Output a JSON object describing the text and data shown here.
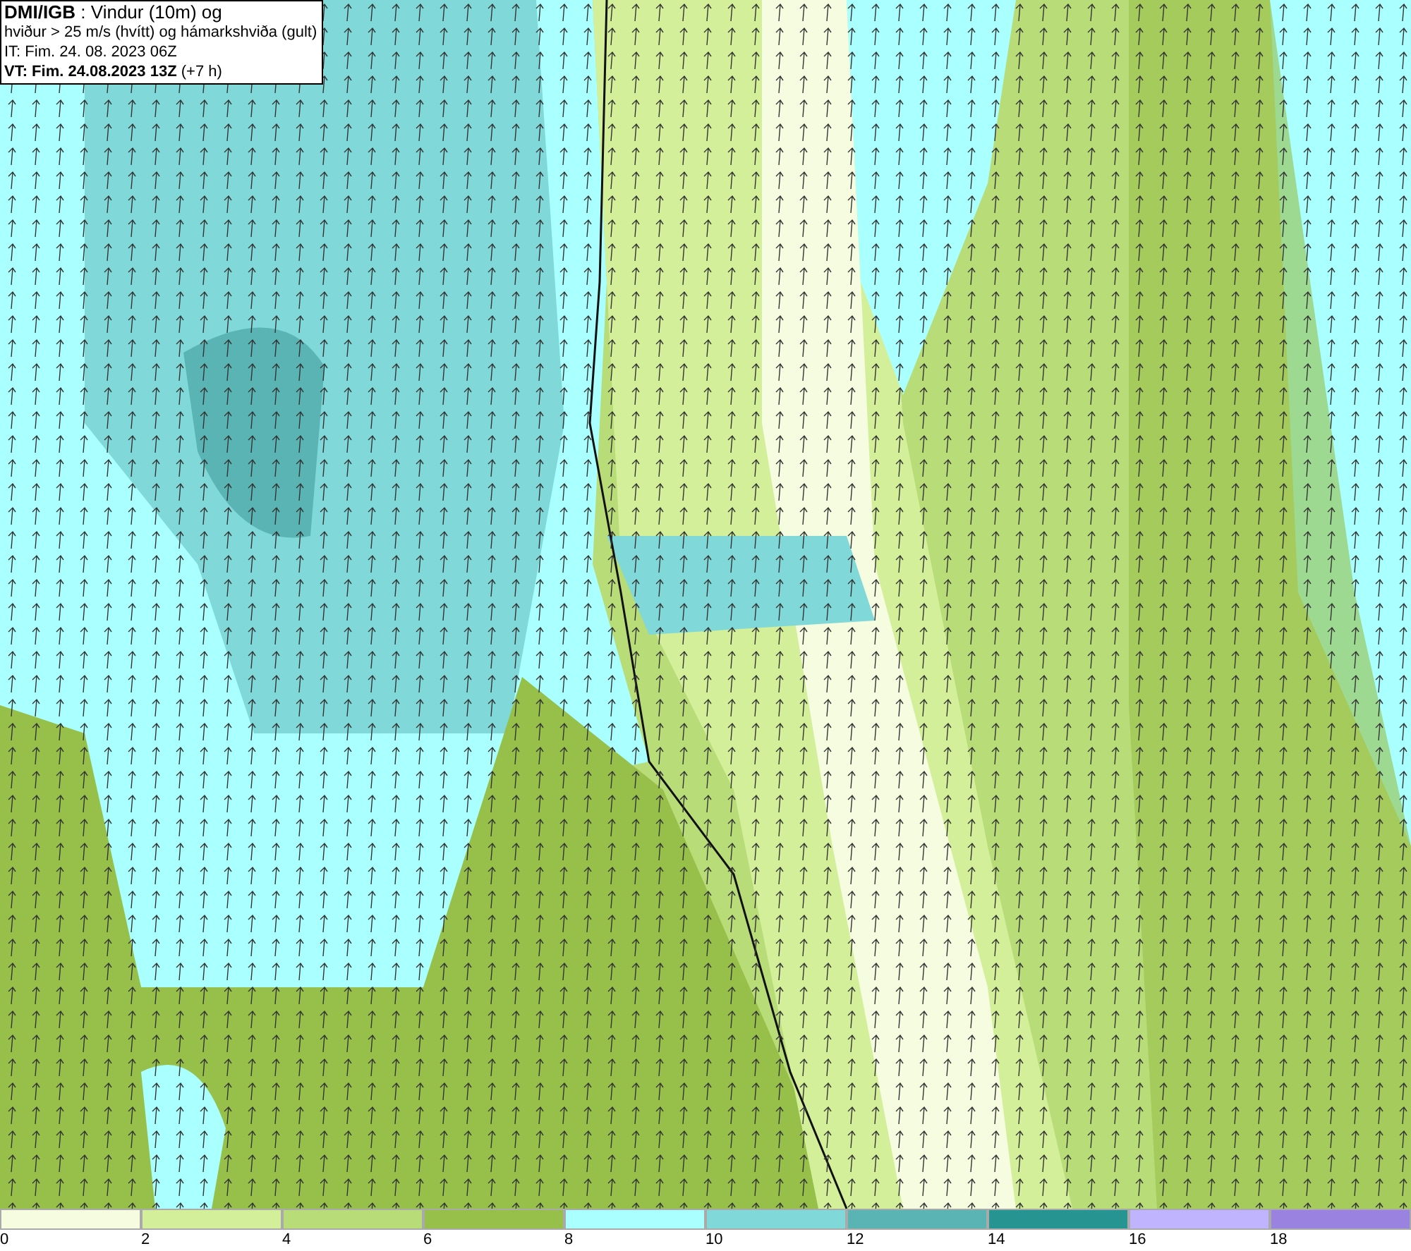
{
  "header": {
    "lines": [
      "**DMI/IGB** : Vindur (10m) og",
      "hviður > 25 m/s (hvítt) og hámarkshviða (gult)",
      "IT: Fim. 24. 08. 2023 06Z",
      "**VT: Fim. 24.08.2023 13Z** (+7 h)"
    ]
  },
  "legend": {
    "bins": [
      {
        "color": "#f5fce0",
        "label": "0"
      },
      {
        "color": "#d4ef9a",
        "label": "2"
      },
      {
        "color": "#b8dc78",
        "label": "4"
      },
      {
        "color": "#96c04a",
        "label": "6"
      },
      {
        "color": "#aaffff",
        "label": "8"
      },
      {
        "color": "#80d8d8",
        "label": "10"
      },
      {
        "color": "#5ab4b4",
        "label": "12"
      },
      {
        "color": "#269490",
        "label": "14"
      },
      {
        "color": "#c0b4ff",
        "label": "16"
      },
      {
        "color": "#9a82e0",
        "label": "18"
      }
    ]
  }
}
